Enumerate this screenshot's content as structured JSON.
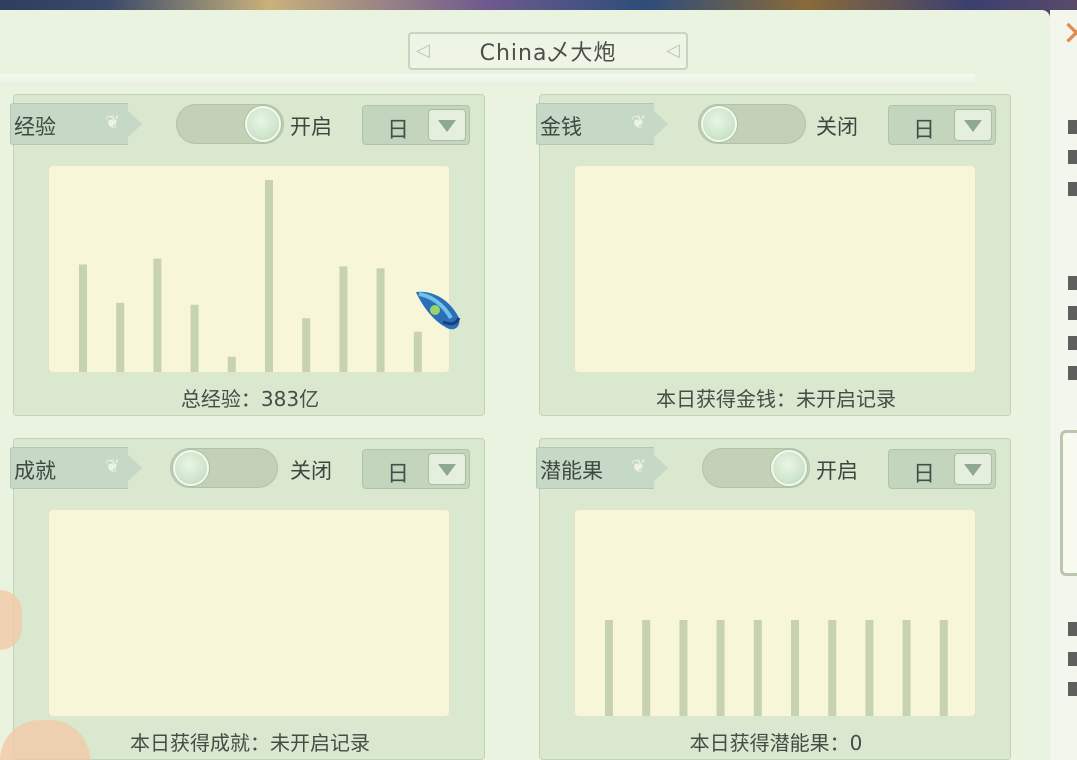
{
  "window": {
    "title": "China乄大炮",
    "close_glyph": "✕"
  },
  "panels": {
    "exp": {
      "label": "经验",
      "toggle_state": "on",
      "toggle_label": "开启",
      "period": "日",
      "caption": "总经验：383亿"
    },
    "money": {
      "label": "金钱",
      "toggle_state": "off",
      "toggle_label": "关闭",
      "period": "日",
      "caption": "本日获得金钱：未开启记录"
    },
    "achievement": {
      "label": "成就",
      "toggle_state": "off",
      "toggle_label": "关闭",
      "period": "日",
      "caption": "本日获得成就：未开启记录"
    },
    "potential": {
      "label": "潜能果",
      "toggle_state": "on",
      "toggle_label": "开启",
      "period": "日",
      "caption": "本日获得潜能果：0"
    }
  },
  "chart_data": [
    {
      "type": "bar",
      "values": [
        0.56,
        0.36,
        0.59,
        0.35,
        0.08,
        1.0,
        0.28,
        0.55,
        0.54,
        0.21
      ]
    },
    {
      "type": "bar",
      "values": [
        0.5,
        0.5,
        0.5,
        0.5,
        0.5,
        0.5,
        0.5,
        0.5,
        0.5,
        0.5
      ]
    }
  ],
  "colors": {
    "window_bg": "#eaf2e0",
    "panel_bg": "#dbe8d0",
    "chart_bg": "#f7f6d9",
    "bar": "#c6d2b2",
    "close_accent": "#e38a50"
  },
  "icons": {
    "close": "close-icon",
    "dropdown": "chevron-down-icon",
    "cursor": "leaf-cursor-icon"
  }
}
